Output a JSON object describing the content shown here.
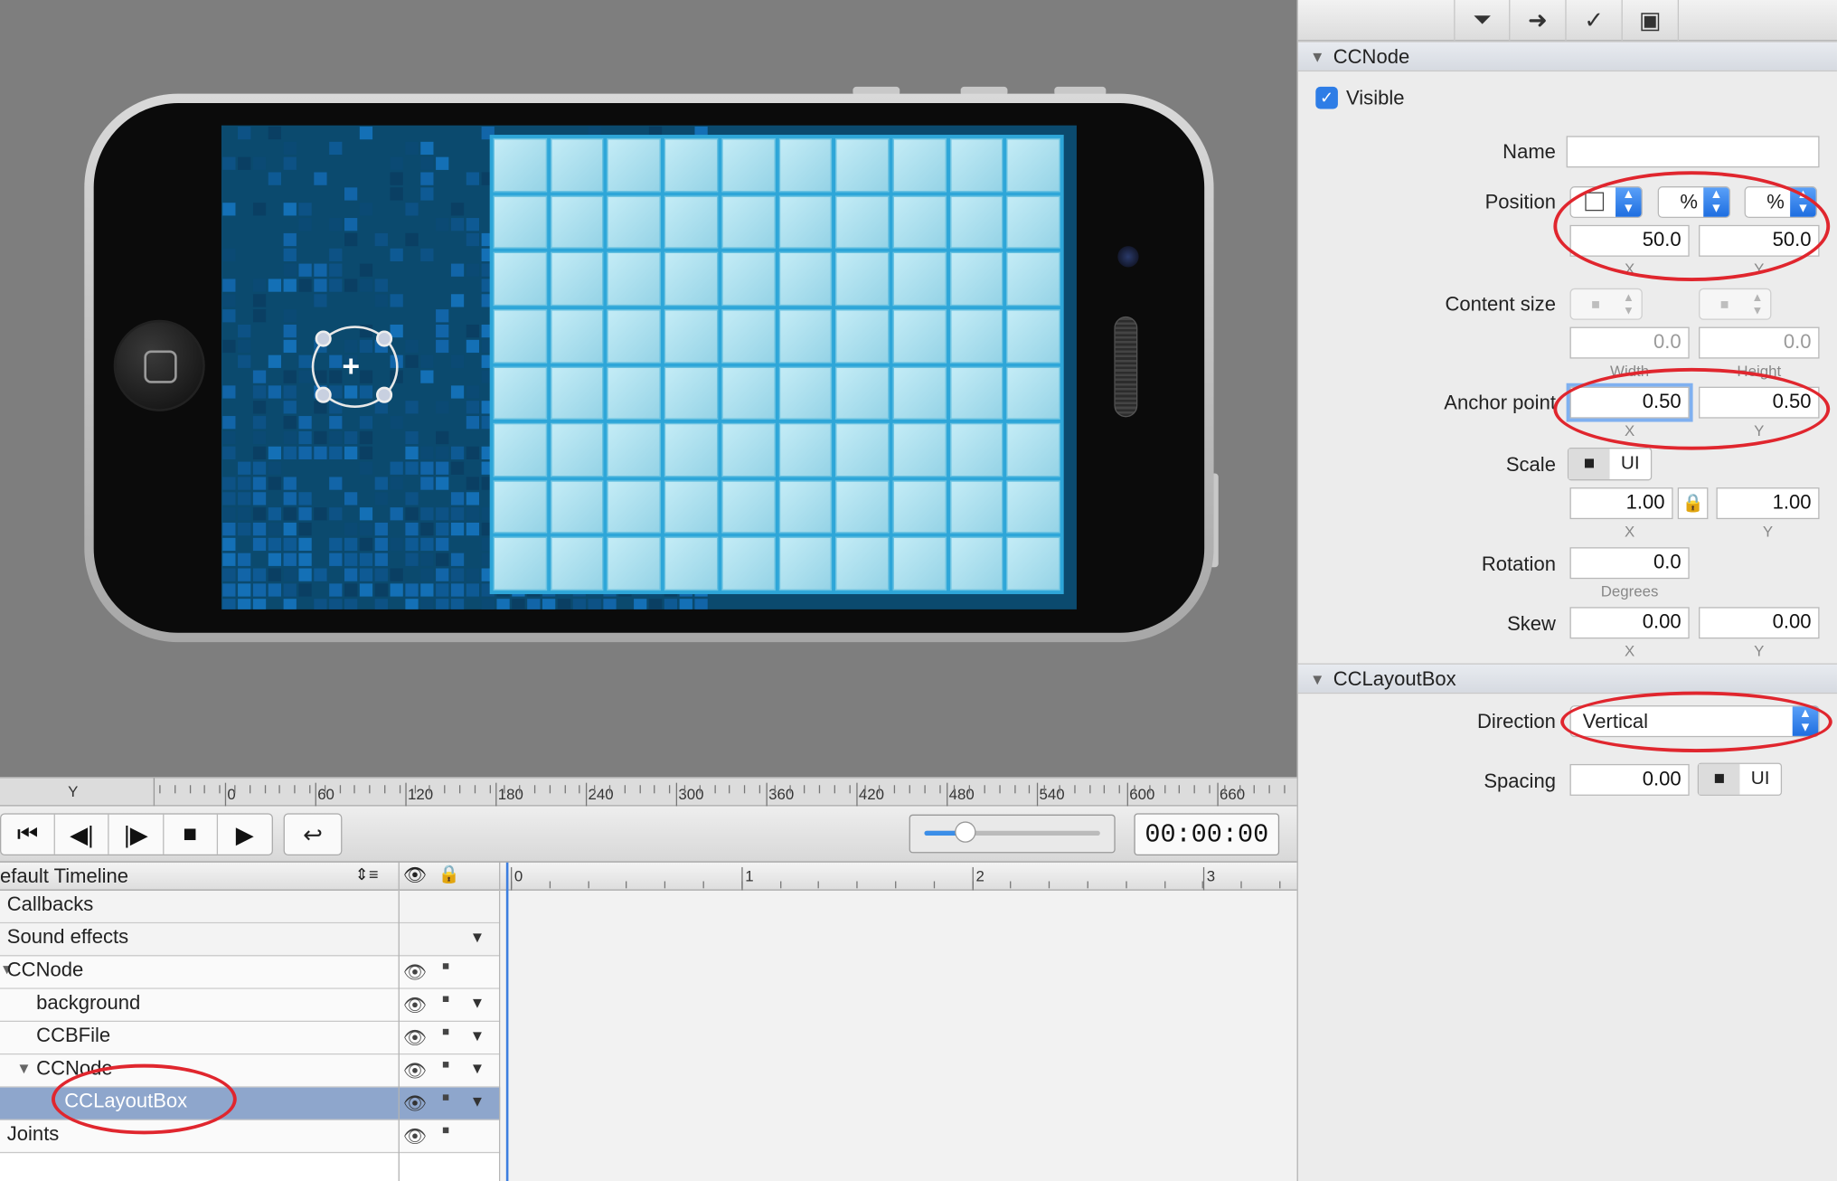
{
  "ruler": {
    "label": "Y",
    "ticks": [
      "0",
      "60",
      "120",
      "180",
      "240",
      "300",
      "360",
      "420",
      "480",
      "540",
      "600",
      "660"
    ]
  },
  "transport": {
    "timecode": "00:00:00"
  },
  "timeline": {
    "title": "efault Timeline",
    "ticks": [
      "0",
      "1",
      "2",
      "3"
    ],
    "rows": [
      {
        "label": "Callbacks"
      },
      {
        "label": "Sound effects"
      },
      {
        "label": "CCNode"
      },
      {
        "label": "background"
      },
      {
        "label": "CCBFile"
      },
      {
        "label": "CCNode"
      },
      {
        "label": "CCLayoutBox"
      },
      {
        "label": "Joints"
      }
    ]
  },
  "inspector": {
    "icons": [
      "plug-icon",
      "arrow-circle-icon",
      "physics-icon",
      "layers-icon"
    ],
    "ccnode": {
      "header": "CCNode",
      "visible_label": "Visible",
      "name_label": "Name",
      "name_value": "",
      "position_label": "Position",
      "position_unit_x": "%",
      "position_unit_y": "%",
      "position_x": "50.0",
      "position_y": "50.0",
      "x_caption": "X",
      "y_caption": "Y",
      "content_size_label": "Content size",
      "content_w": "0.0",
      "content_h": "0.0",
      "width_caption": "Width",
      "height_caption": "Height",
      "anchor_label": "Anchor point",
      "anchor_x": "0.50",
      "anchor_y": "0.50",
      "scale_label": "Scale",
      "scale_ui": "UI",
      "scale_x": "1.00",
      "scale_y": "1.00",
      "rotation_label": "Rotation",
      "rotation_value": "0.0",
      "degrees_caption": "Degrees",
      "skew_label": "Skew",
      "skew_x": "0.00",
      "skew_y": "0.00"
    },
    "layoutbox": {
      "header": "CCLayoutBox",
      "direction_label": "Direction",
      "direction_value": "Vertical",
      "spacing_label": "Spacing",
      "spacing_value": "0.00",
      "spacing_ui": "UI"
    }
  },
  "colors": {
    "selection": "#8ea6cc",
    "annotation": "#e0262e",
    "accent": "#1e6ee0"
  }
}
